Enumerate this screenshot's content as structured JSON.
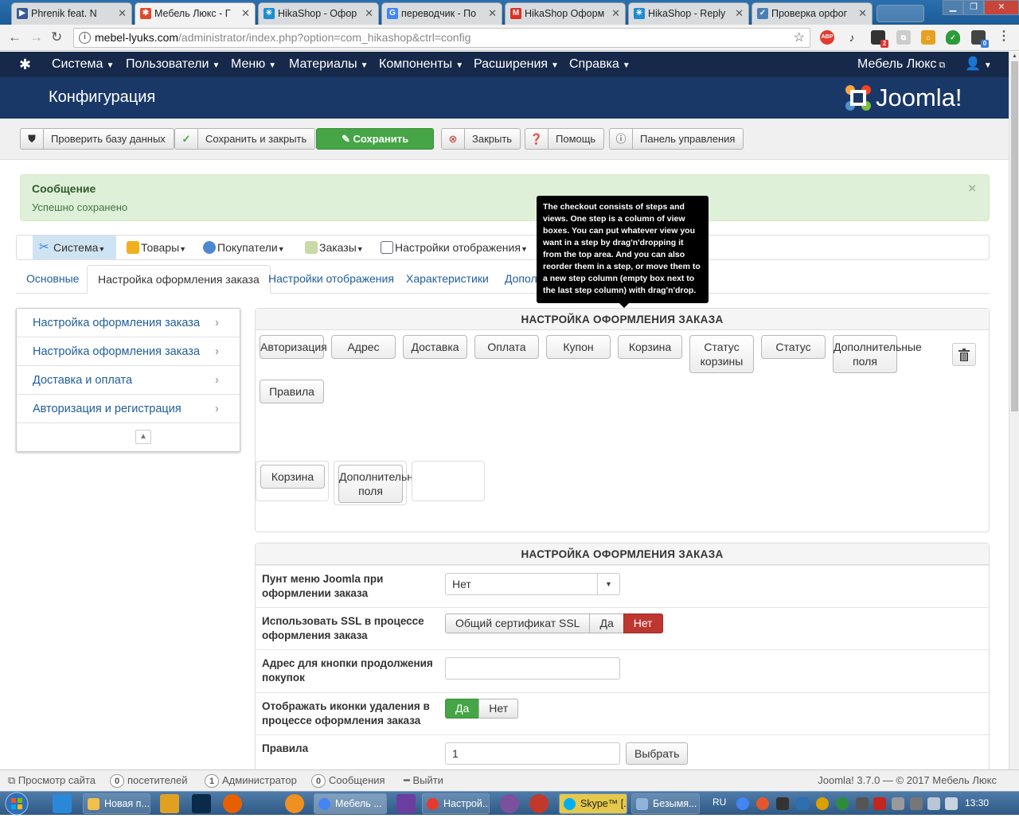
{
  "browser": {
    "tabs": [
      {
        "label": "Phrenik feat. N",
        "icon_color": "#3b5998"
      },
      {
        "label": "Мебель Люкс - Г",
        "icon_color": "#e04a28"
      },
      {
        "label": "HikaShop - Офор",
        "icon_color": "#1e8ccf"
      },
      {
        "label": "переводчик - По",
        "icon_color": "#4285f4"
      },
      {
        "label": "HikaShop Оформ",
        "icon_color": "#d93025"
      },
      {
        "label": "HikaShop - Reply",
        "icon_color": "#1e8ccf"
      },
      {
        "label": "Проверка орфог",
        "icon_color": "#4a7fb5"
      }
    ],
    "url_host": "mebel-lyuks.com",
    "url_path": "/administrator/index.php?option=com_hikashop&ctrl=config",
    "ext_badge_1": "2",
    "ext_badge_2": "0"
  },
  "joomla_nav": {
    "items": [
      "Система",
      "Пользователи",
      "Меню",
      "Материалы",
      "Компоненты",
      "Расширения",
      "Справка"
    ],
    "site_name": "Мебель Люкс"
  },
  "header": {
    "title": "Конфигурация",
    "logo_text": "Joomla!"
  },
  "toolbar": {
    "check_db": "Проверить базу данных",
    "save_close": "Сохранить и закрыть",
    "save": "Сохранить",
    "close": "Закрыть",
    "help": "Помощь",
    "control_panel": "Панель управления"
  },
  "message": {
    "heading": "Сообщение",
    "body": "Успешно сохранено"
  },
  "hika_menu": {
    "items": [
      "Система",
      "Товары",
      "Покупатели",
      "Заказы",
      "Настройки отображения"
    ],
    "active": "Система"
  },
  "subtabs": {
    "items": [
      "Основные",
      "Настройка оформления заказа",
      "Настройки отображения",
      "Характеристики",
      "Дополн"
    ],
    "active": "Настройка оформления заказа"
  },
  "sidebar": {
    "items": [
      "Настройка оформления заказа",
      "Настройка оформления заказа",
      "Доставка и оплата",
      "Авторизация и регистрация"
    ]
  },
  "tooltip": {
    "text": "The checkout consists of steps and views. One step is a column of view boxes. You can put whatever view you want in a step by drag'n'dropping it from the top area. And you can also reorder them in a step, or move them to a new step column (empty box next to the last step column) with drag'n'drop."
  },
  "workflow_panel": {
    "title": "НАСТРОЙКА ОФОРМЛЕНИЯ ЗАКАЗА",
    "views": [
      "Авторизация",
      "Адрес",
      "Доставка",
      "Оплата",
      "Купон",
      "Корзина",
      "Статус корзины",
      "Статус",
      "Дополнительные поля",
      "Правила"
    ],
    "step1": [
      "Корзина"
    ],
    "step2": [
      "Дополнительные поля"
    ]
  },
  "settings_panel": {
    "title": "НАСТРОЙКА ОФОРМЛЕНИЯ ЗАКАЗА",
    "menu_label": "Пунт меню Joomla при оформлении заказа",
    "menu_value": "Нет",
    "ssl_label": "Использовать SSL в процессе оформления заказа",
    "ssl_options": [
      "Общий сертификат SSL",
      "Да",
      "Нет"
    ],
    "ssl_selected": "Нет",
    "continue_label": "Адрес для кнопки продолжения покупок",
    "continue_value": "",
    "delete_icons_label": "Отображать иконки удаления в процессе оформления заказа",
    "delete_icons_options": [
      "Да",
      "Нет"
    ],
    "delete_icons_selected": "Да",
    "rules_label": "Правила",
    "rules_value": "1",
    "rules_button": "Выбрать"
  },
  "statusbar": {
    "view_site": "Просмотр сайта",
    "visitors_count": "0",
    "visitors_label": "посетителей",
    "admins_count": "1",
    "admins_label": "Администратор",
    "messages_count": "0",
    "messages_label": "Сообщения",
    "logout": "Выйти",
    "version": "Joomla! 3.7.0 — © 2017 Мебель Люкс"
  },
  "taskbar": {
    "items": [
      "Новая п...",
      "Мебель ...",
      "Настрой...",
      "Skype™ [...",
      "Безымя..."
    ],
    "lang": "RU",
    "time": "13:30"
  }
}
